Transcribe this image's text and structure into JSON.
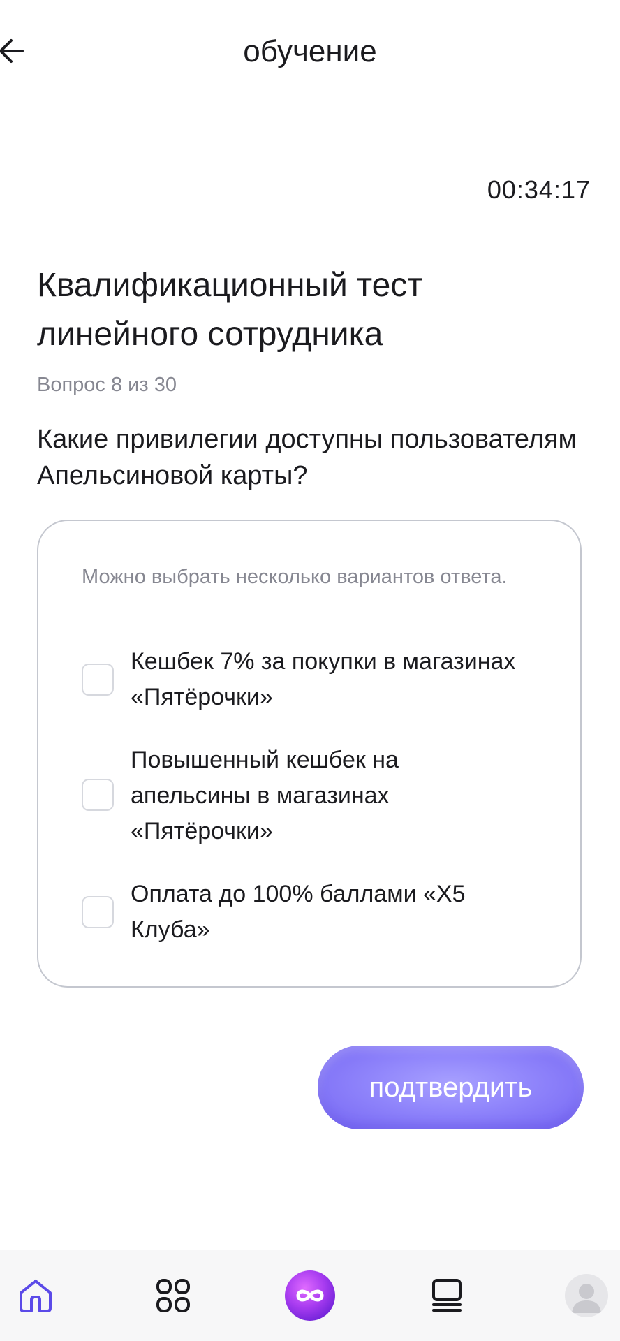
{
  "header": {
    "title": "обучение",
    "back_icon": "arrow-left-icon"
  },
  "timer": "00:34:17",
  "test": {
    "title": "Квалификационный тест линейного сотрудника",
    "counter": "Вопрос 8 из 30",
    "question": "Какие привилегии доступны пользователям Апельсиновой карты?",
    "hint": "Можно выбрать несколько вариантов ответа.",
    "options": [
      {
        "label": "Кешбек 7% за покупки в магазинах «Пятёрочки»",
        "checked": false
      },
      {
        "label": "Повышенный кешбек на апельсины в магазинах «Пятёрочки»",
        "checked": false
      },
      {
        "label": "Оплата до 100% баллами «Х5 Клуба»",
        "checked": false
      }
    ]
  },
  "confirm_button": {
    "label": "подтвердить",
    "color": "#8f84fb"
  },
  "bottom_nav": {
    "items": [
      {
        "icon": "home-icon",
        "active": true
      },
      {
        "icon": "apps-grid-icon",
        "active": false
      },
      {
        "icon": "infinity-logo-icon",
        "active": false
      },
      {
        "icon": "courses-list-icon",
        "active": false
      },
      {
        "icon": "profile-avatar-icon",
        "active": false
      }
    ]
  },
  "colors": {
    "accent": "#5b4ae8",
    "text_primary": "#1b1b1f",
    "text_secondary": "#868791",
    "card_border": "#c4c7cf",
    "nav_background": "#f7f7f8"
  }
}
